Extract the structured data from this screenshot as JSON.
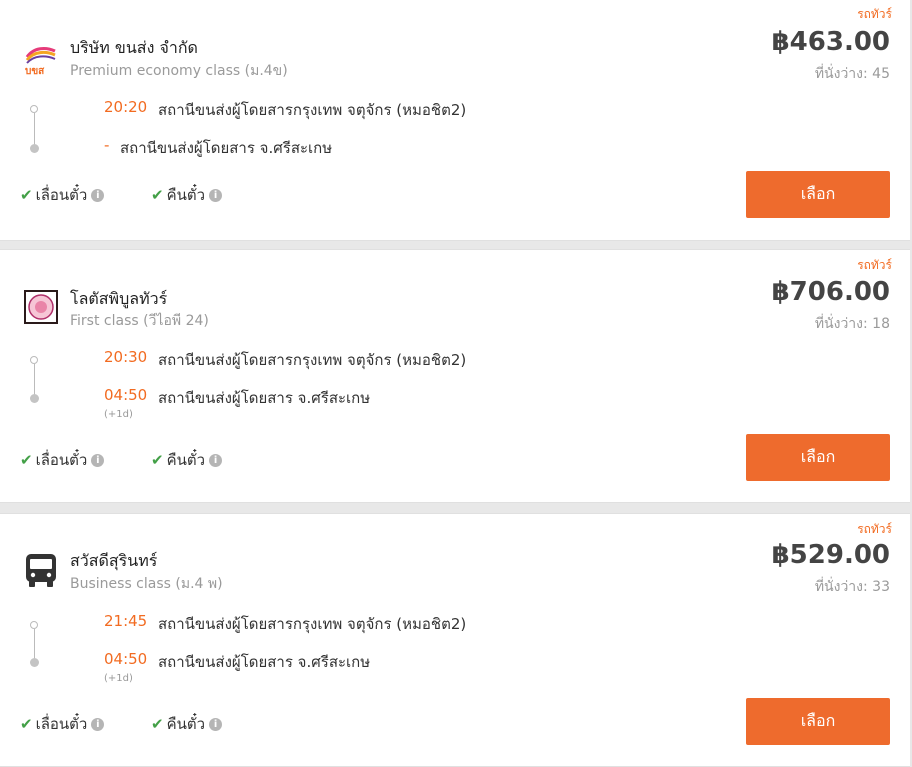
{
  "results": [
    {
      "bus_type": "รถทัวร์",
      "operator": "บริษัท ขนส่ง จำกัด",
      "bus_class": "Premium economy class (ม.4ข)",
      "price": "฿463.00",
      "seats": "ที่นั่งว่าง: 45",
      "departure_time": "20:20",
      "departure_station": "สถานีขนส่งผู้โดยสารกรุงเทพ จตุจักร (หมอชิต2)",
      "arrival_time": "-",
      "arrival_station": "สถานีขนส่งผู้โดยสาร จ.ศรีสะเกษ",
      "next_day": "",
      "feature_reschedule": "เลื่อนตั๋ว",
      "feature_refund": "คืนตั๋ว",
      "select_label": "เลือก",
      "logo_text": "บขส"
    },
    {
      "bus_type": "รถทัวร์",
      "operator": "โลตัสพิบูลทัวร์",
      "bus_class": "First class (วีไอพี 24)",
      "price": "฿706.00",
      "seats": "ที่นั่งว่าง: 18",
      "departure_time": "20:30",
      "departure_station": "สถานีขนส่งผู้โดยสารกรุงเทพ จตุจักร (หมอชิต2)",
      "arrival_time": "04:50",
      "arrival_station": "สถานีขนส่งผู้โดยสาร จ.ศรีสะเกษ",
      "next_day": "(+1d)",
      "feature_reschedule": "เลื่อนตั๋ว",
      "feature_refund": "คืนตั๋ว",
      "select_label": "เลือก"
    },
    {
      "bus_type": "รถทัวร์",
      "operator": "สวัสดีสุรินทร์",
      "bus_class": "Business class (ม.4 พ)",
      "price": "฿529.00",
      "seats": "ที่นั่งว่าง: 33",
      "departure_time": "21:45",
      "departure_station": "สถานีขนส่งผู้โดยสารกรุงเทพ จตุจักร (หมอชิต2)",
      "arrival_time": "04:50",
      "arrival_station": "สถานีขนส่งผู้โดยสาร จ.ศรีสะเกษ",
      "next_day": "(+1d)",
      "feature_reschedule": "เลื่อนตั๋ว",
      "feature_refund": "คืนตั๋ว",
      "select_label": "เลือก"
    }
  ],
  "icons": {
    "check": "check-icon",
    "info": "info-icon",
    "info_glyph": "i"
  },
  "colors": {
    "accent": "#f26b21",
    "button": "#ee6b2d",
    "check": "#43a047"
  }
}
